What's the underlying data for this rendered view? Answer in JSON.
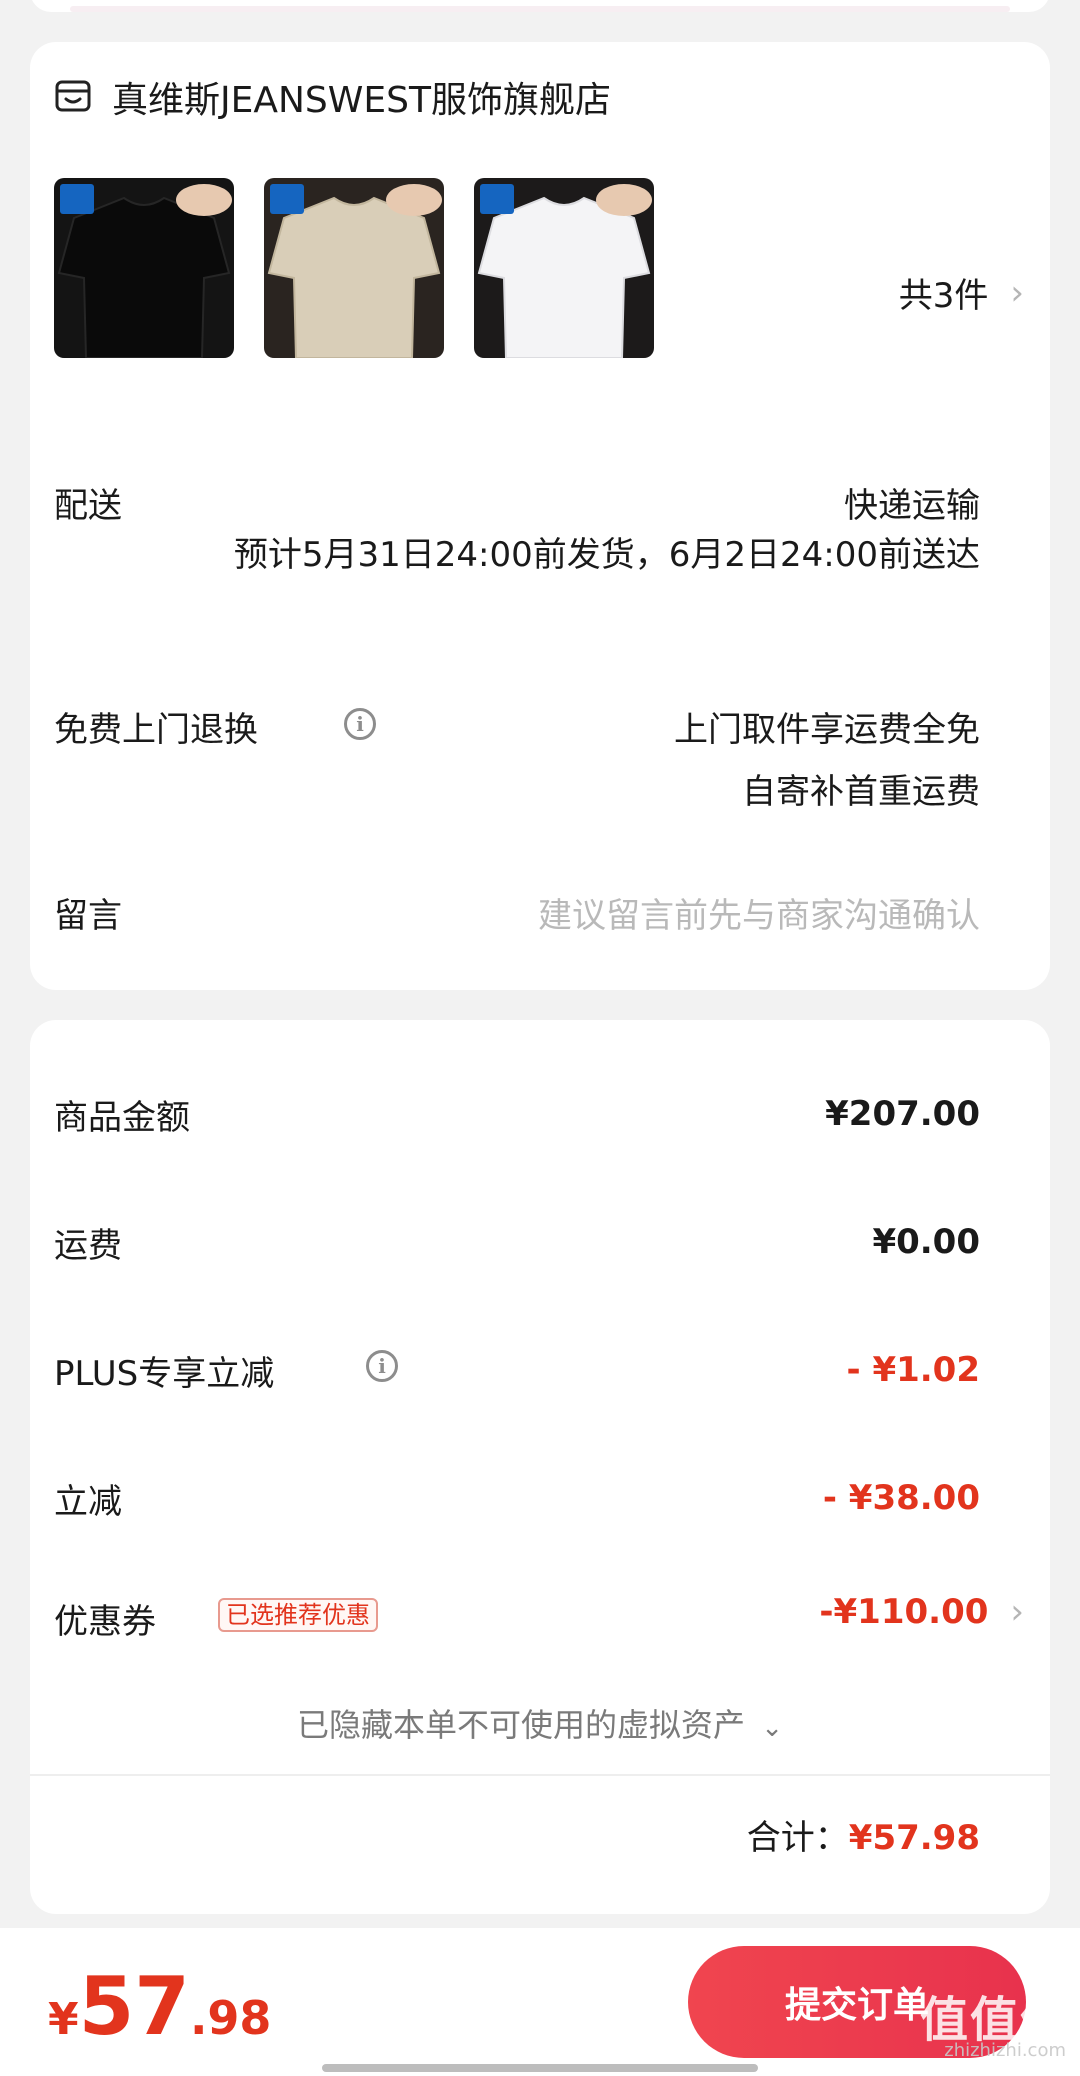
{
  "shop": {
    "name": "真维斯JEANSWEST服饰旗舰店",
    "item_count": "共3件"
  },
  "products": [
    {
      "color": "#141414",
      "shirt": "#0e0e0e"
    },
    {
      "color": "#2a2420",
      "shirt": "#d9ceb8"
    },
    {
      "color": "#1c1a1a",
      "shirt": "#f4f4f6"
    }
  ],
  "delivery": {
    "label": "配送",
    "method": "快递运输",
    "estimate": "预计5月31日24:00前发货，6月2日24:00前送达"
  },
  "returns": {
    "label": "免费上门退换",
    "line1": "上门取件享运费全免",
    "line2": "自寄补首重运费"
  },
  "message": {
    "label": "留言",
    "placeholder": "建议留言前先与商家沟通确认"
  },
  "summary": {
    "goods_label": "商品金额",
    "goods_value": "¥207.00",
    "shipping_label": "运费",
    "shipping_value": "¥0.00",
    "plus_label": "PLUS专享立减",
    "plus_value": "- ¥1.02",
    "discount_label": "立减",
    "discount_value": "- ¥38.00",
    "coupon_label": "优惠券",
    "coupon_tag": "已选推荐优惠",
    "coupon_value": "-¥110.00",
    "hidden_assets": "已隐藏本单不可使用的虚拟资产",
    "total_label": "合计：",
    "total_value": "¥57.98"
  },
  "footer": {
    "yen": "¥",
    "total_int": "57",
    "total_dec": ".98",
    "submit_label": "提交订单",
    "watermark": "值值值",
    "watermark_site": "zhizhizhi.com"
  },
  "colors": {
    "accent_red": "#e2341d",
    "button_red": "#ee3c4e"
  }
}
